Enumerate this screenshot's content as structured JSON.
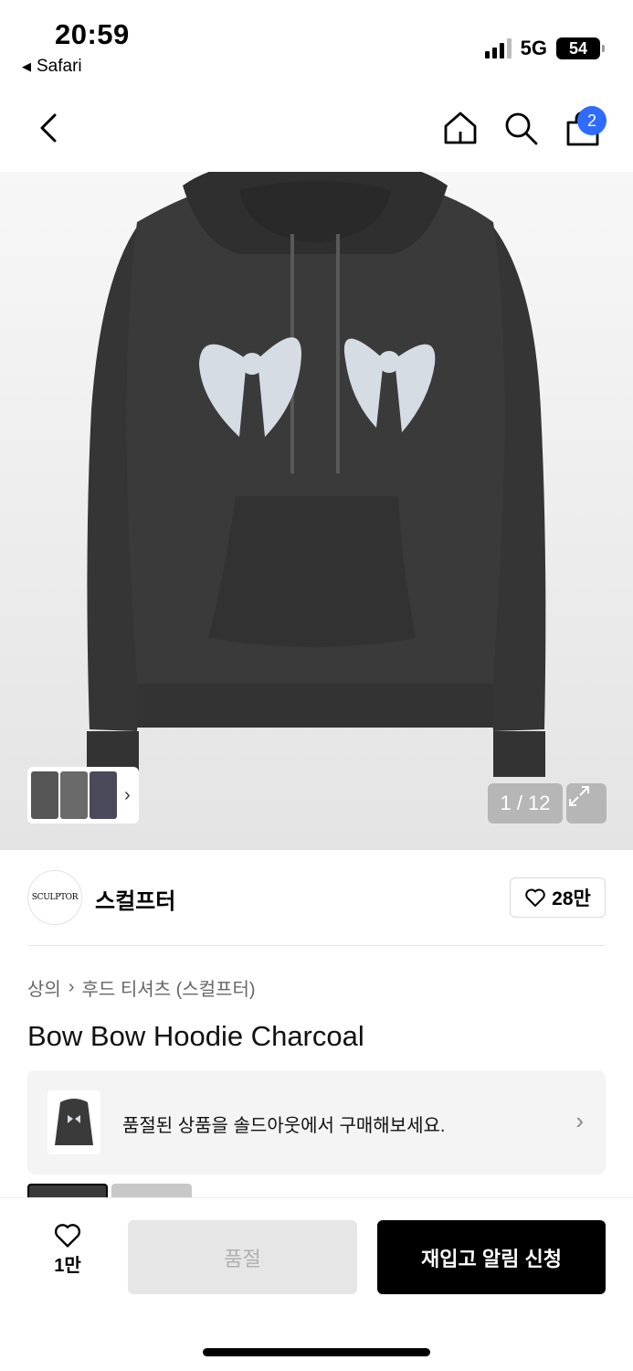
{
  "status_bar": {
    "time": "20:59",
    "back_app": "Safari",
    "network": "5G",
    "battery": "54"
  },
  "nav": {
    "cart_count": "2"
  },
  "gallery": {
    "counter": "1 / 12"
  },
  "brand": {
    "logo_text": "SCULPTOR",
    "name": "스컬프터",
    "likes": "28만"
  },
  "breadcrumb": {
    "category": "상의",
    "separator": "›",
    "subcategory": "후드 티셔츠 (스컬프터)"
  },
  "product": {
    "title": "Bow Bow Hoodie Charcoal"
  },
  "soldout_banner": {
    "text": "품절된 상품을 솔드아웃에서 구매해보세요."
  },
  "bottom_bar": {
    "like_count": "1만",
    "soldout_label": "품절",
    "restock_label": "재입고 알림 신청"
  },
  "colors": {
    "accent_badge": "#2f6bff",
    "hoodie": "#3b3a3a",
    "bow": "#d6dce4"
  }
}
